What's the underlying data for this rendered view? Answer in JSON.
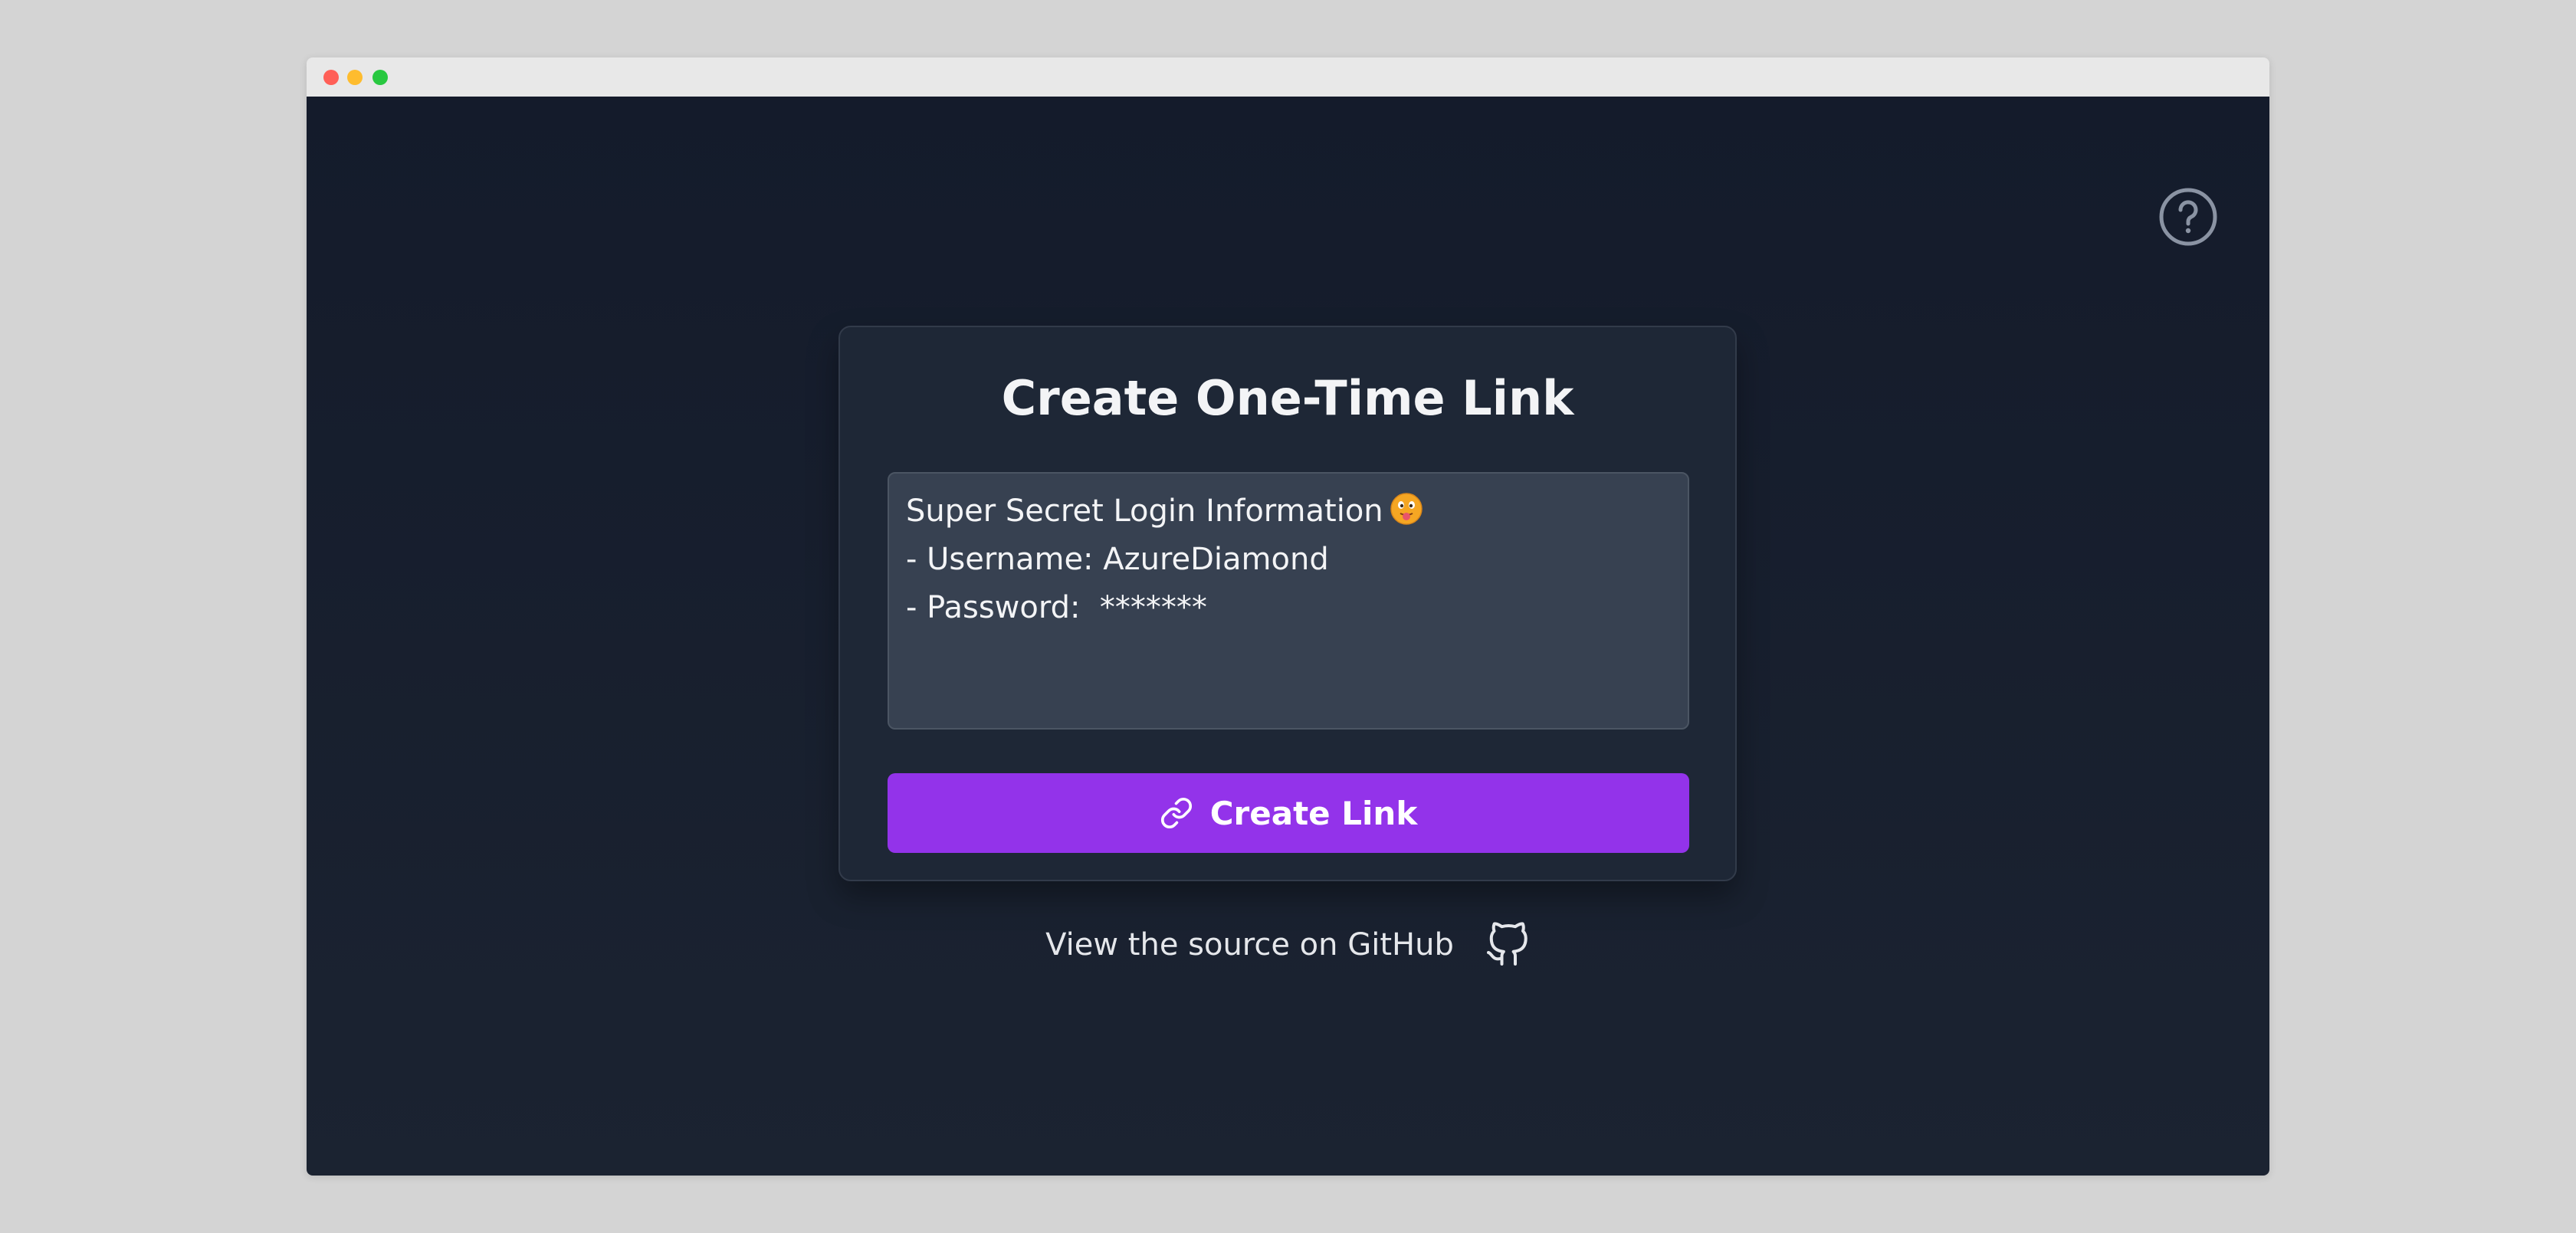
{
  "card": {
    "title": "Create One-Time Link",
    "secret_lines": [
      "Super Secret Login Information",
      "- Username: AzureDiamond",
      "- Password:  *******"
    ],
    "create_button_label": "Create Link"
  },
  "footer": {
    "github_link_text": "View the source on GitHub"
  },
  "icons": {
    "help": "help-circle-icon",
    "link": "link-icon",
    "github": "github-icon",
    "emoji": "face-with-tongue-emoji"
  },
  "colors": {
    "background": "#141b2b",
    "card": "#1e2736",
    "textarea": "#374151",
    "accent": "#9333ea"
  }
}
